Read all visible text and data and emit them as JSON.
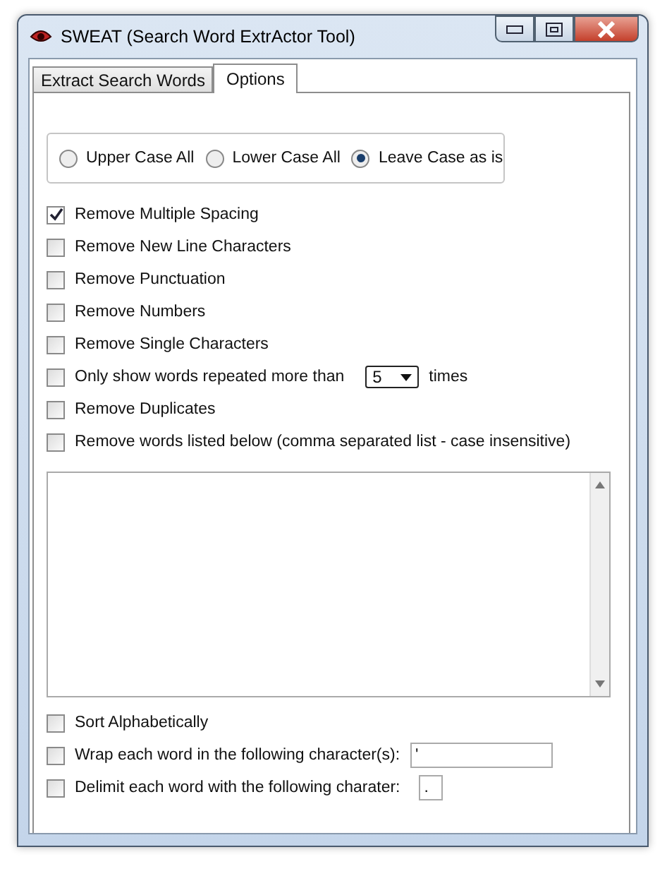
{
  "window": {
    "title": "SWEAT (Search Word ExtrActor Tool)"
  },
  "tabs": [
    {
      "label": "Extract Search Words",
      "selected": false
    },
    {
      "label": "Options",
      "selected": true
    }
  ],
  "case_options": [
    {
      "label": "Upper Case All",
      "selected": false
    },
    {
      "label": "Lower Case All",
      "selected": false
    },
    {
      "label": "Leave Case as is",
      "selected": true
    }
  ],
  "options": [
    {
      "kind": "checkbox",
      "label": "Remove Multiple Spacing",
      "checked": true
    },
    {
      "kind": "checkbox",
      "label": "Remove New Line Characters",
      "checked": false
    },
    {
      "kind": "checkbox",
      "label": "Remove Punctuation",
      "checked": false
    },
    {
      "kind": "checkbox",
      "label": "Remove Numbers",
      "checked": false
    },
    {
      "kind": "checkbox",
      "label": "Remove Single Characters",
      "checked": false
    },
    {
      "kind": "select",
      "label": "Only show words repeated more than",
      "checked": false,
      "value": "5",
      "suffix": "times"
    },
    {
      "kind": "checkbox",
      "label": "Remove Duplicates",
      "checked": false
    },
    {
      "kind": "checkbox",
      "label": "Remove words listed below (comma separated list - case insensitive)",
      "checked": false
    }
  ],
  "bottom_options": [
    {
      "kind": "checkbox",
      "label": "Sort Alphabetically",
      "checked": false
    },
    {
      "kind": "field",
      "label": "Wrap each word in the following character(s):",
      "checked": false,
      "value": "'"
    },
    {
      "kind": "small-field",
      "label": "Delimit each word with the following charater:",
      "checked": false,
      "value": "."
    }
  ]
}
